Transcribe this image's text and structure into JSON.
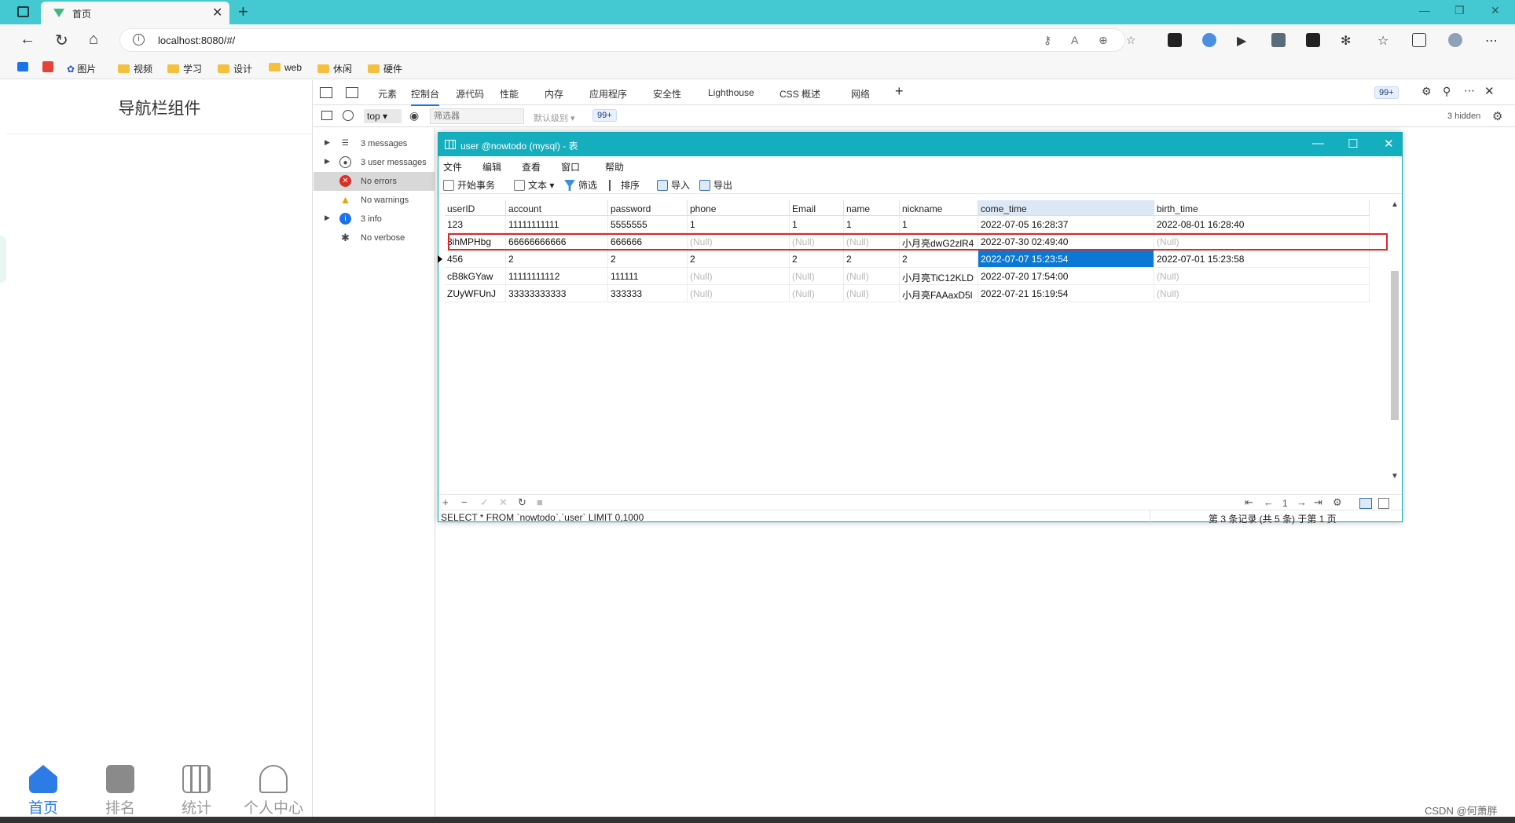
{
  "browser": {
    "tab_title": "首页",
    "url": "localhost:8080/#/",
    "bookmarks": [
      "图片",
      "视频",
      "学习",
      "设计",
      "web",
      "休闲",
      "硬件"
    ]
  },
  "app": {
    "header_title": "导航栏组件",
    "bottom_tabs": [
      {
        "label": "首页",
        "icon": "home-icon",
        "active": true
      },
      {
        "label": "排名",
        "icon": "rank-icon",
        "active": false
      },
      {
        "label": "统计",
        "icon": "chart-icon",
        "active": false
      },
      {
        "label": "个人中心",
        "icon": "user-icon",
        "active": false
      }
    ],
    "accent_color": "#2d7be5"
  },
  "devtools": {
    "tabs": [
      "元素",
      "控制台",
      "源代码",
      "性能",
      "内存",
      "应用程序",
      "安全性",
      "Lighthouse",
      "CSS 概述",
      "网络"
    ],
    "active_tab": "控制台",
    "issues_badge": "99+",
    "context": "top",
    "filter_placeholder": "筛选器",
    "level": "默认级别",
    "hidden": "3 hidden",
    "sidebar": [
      {
        "label": "3 messages",
        "icon": "list-icon"
      },
      {
        "label": "3 user messages",
        "icon": "user-circle-icon"
      },
      {
        "label": "No errors",
        "icon": "error-icon"
      },
      {
        "label": "No warnings",
        "icon": "warning-icon"
      },
      {
        "label": "3 info",
        "icon": "info-icon"
      },
      {
        "label": "No verbose",
        "icon": "bug-icon"
      }
    ]
  },
  "navicat": {
    "title": "user @nowtodo (mysql) - 表",
    "menu": [
      "文件",
      "编辑",
      "查看",
      "窗口",
      "帮助"
    ],
    "toolbar": [
      "开始事务",
      "文本",
      "筛选",
      "排序",
      "导入",
      "导出"
    ],
    "columns": [
      "userID",
      "account",
      "password",
      "phone",
      "Email",
      "name",
      "nickname",
      "come_time",
      "birth_time"
    ],
    "rows": [
      [
        "123",
        "11111111111",
        "5555555",
        "1",
        "1",
        "1",
        "1",
        "2022-07-05 16:28:37",
        "2022-08-01 16:28:40"
      ],
      [
        "3ihMPHbg",
        "66666666666",
        "666666",
        "(Null)",
        "(Null)",
        "(Null)",
        "小月亮dwG2zlR4",
        "2022-07-30 02:49:40",
        "(Null)"
      ],
      [
        "456",
        "2",
        "2",
        "2",
        "2",
        "2",
        "2",
        "2022-07-07 15:23:54",
        "2022-07-01 15:23:58"
      ],
      [
        "cB8kGYaw",
        "11111111112",
        "111111",
        "(Null)",
        "(Null)",
        "(Null)",
        "小月亮TiC12KLD",
        "2022-07-20 17:54:00",
        "(Null)"
      ],
      [
        "ZUyWFUnJ",
        "33333333333",
        "333333",
        "(Null)",
        "(Null)",
        "(Null)",
        "小月亮FAAaxD5l",
        "2022-07-21 15:19:54",
        "(Null)"
      ]
    ],
    "page_number": "1",
    "sql": "SELECT * FROM `nowtodo`.`user` LIMIT 0,1000",
    "record_info": "第 3 条记录 (共 5 条) 于第 1 页"
  },
  "watermark": "CSDN @何萧胖"
}
